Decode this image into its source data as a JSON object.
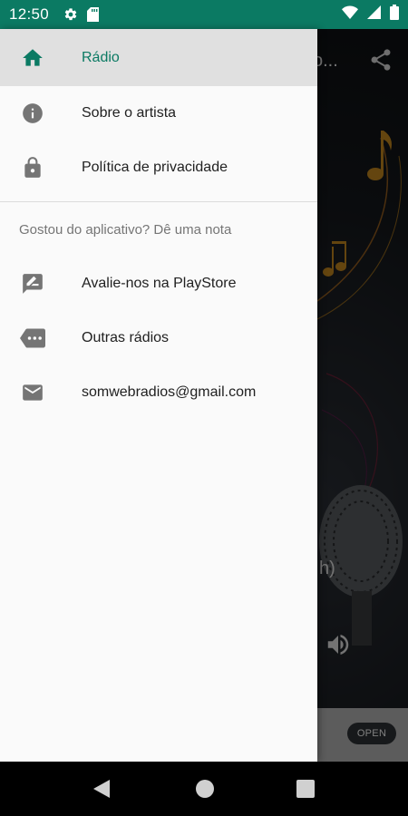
{
  "status_bar": {
    "time": "12:50",
    "left_icons": [
      "gear-icon",
      "sd-card-icon"
    ],
    "right_icons": [
      "wifi-icon",
      "cellular-icon",
      "battery-icon"
    ],
    "color": "#0b7a63"
  },
  "background_app": {
    "title_fragment": "o...",
    "paren_fragment": "h)",
    "ad_button": "OPEN"
  },
  "drawer": {
    "items": [
      {
        "label": "Rádio",
        "icon": "home-icon",
        "active": true
      },
      {
        "label": "Sobre o artista",
        "icon": "info-icon"
      },
      {
        "label": "Política de privacidade",
        "icon": "lock-icon"
      }
    ],
    "section_title": "Gostou do aplicativo? Dê uma nota",
    "section_items": [
      {
        "label": "Avalie-nos na PlayStore",
        "icon": "rate-review-icon"
      },
      {
        "label": "Outras rádios",
        "icon": "label-more-icon"
      },
      {
        "label": "somwebradios@gmail.com",
        "icon": "email-icon"
      }
    ],
    "accent_color": "#0b7a63"
  },
  "nav_bar": {
    "buttons": [
      "back-icon",
      "home-circle-icon",
      "recents-icon"
    ]
  }
}
